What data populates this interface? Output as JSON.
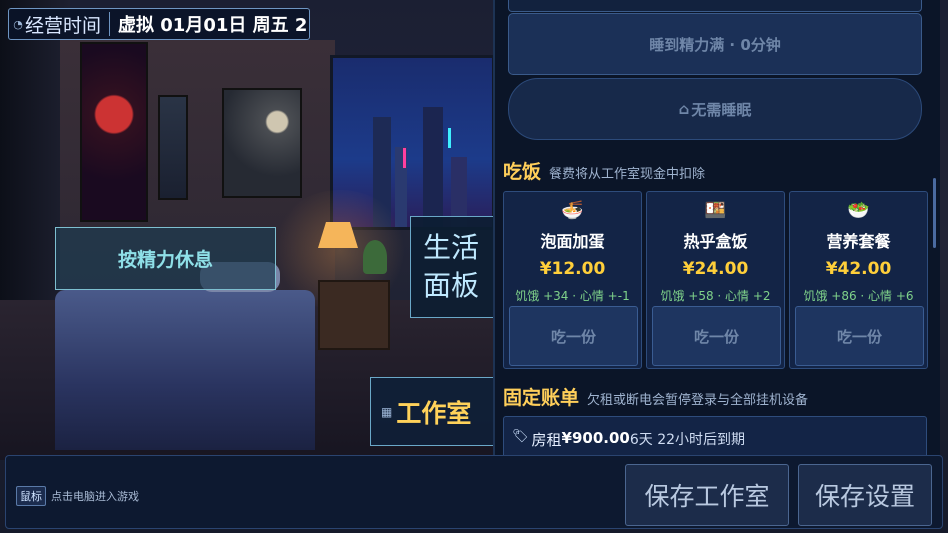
{
  "clock": {
    "label": "经营时间",
    "time": "虚拟 01月01日 周五 2"
  },
  "scene": {
    "rest_button": "按精力休息",
    "life_panel_button": "生活面板",
    "studio_button": "工作室"
  },
  "sleep": {
    "sleep_full_label": "睡到精力满 · 0分钟",
    "no_sleep_label": "无需睡眠"
  },
  "eat": {
    "title": "吃饭",
    "subtitle": "餐费将从工作室现金中扣除",
    "items": [
      {
        "icon": "noodle-bowl-icon",
        "name": "泡面加蛋",
        "price": "¥12.00",
        "stats": "饥饿 +34 · 心情 +-1",
        "button": "吃一份"
      },
      {
        "icon": "bento-box-icon",
        "name": "热乎盒饭",
        "price": "¥24.00",
        "stats": "饥饿 +58 · 心情 +2",
        "button": "吃一份"
      },
      {
        "icon": "meal-plate-icon",
        "name": "营养套餐",
        "price": "¥42.00",
        "stats": "饥饿 +86 · 心情 +6",
        "button": "吃一份"
      }
    ]
  },
  "bills": {
    "title": "固定账单",
    "subtitle": "欠租或断电会暂停登录与全部挂机设备",
    "rent_label": "房租",
    "rent_amount": "¥900.00",
    "rent_due": "6天 22小时后到期"
  },
  "bottom": {
    "mouse_key": "鼠标",
    "hint": "点击电脑进入游戏",
    "save_studio": "保存工作室",
    "save_settings": "保存设置"
  }
}
